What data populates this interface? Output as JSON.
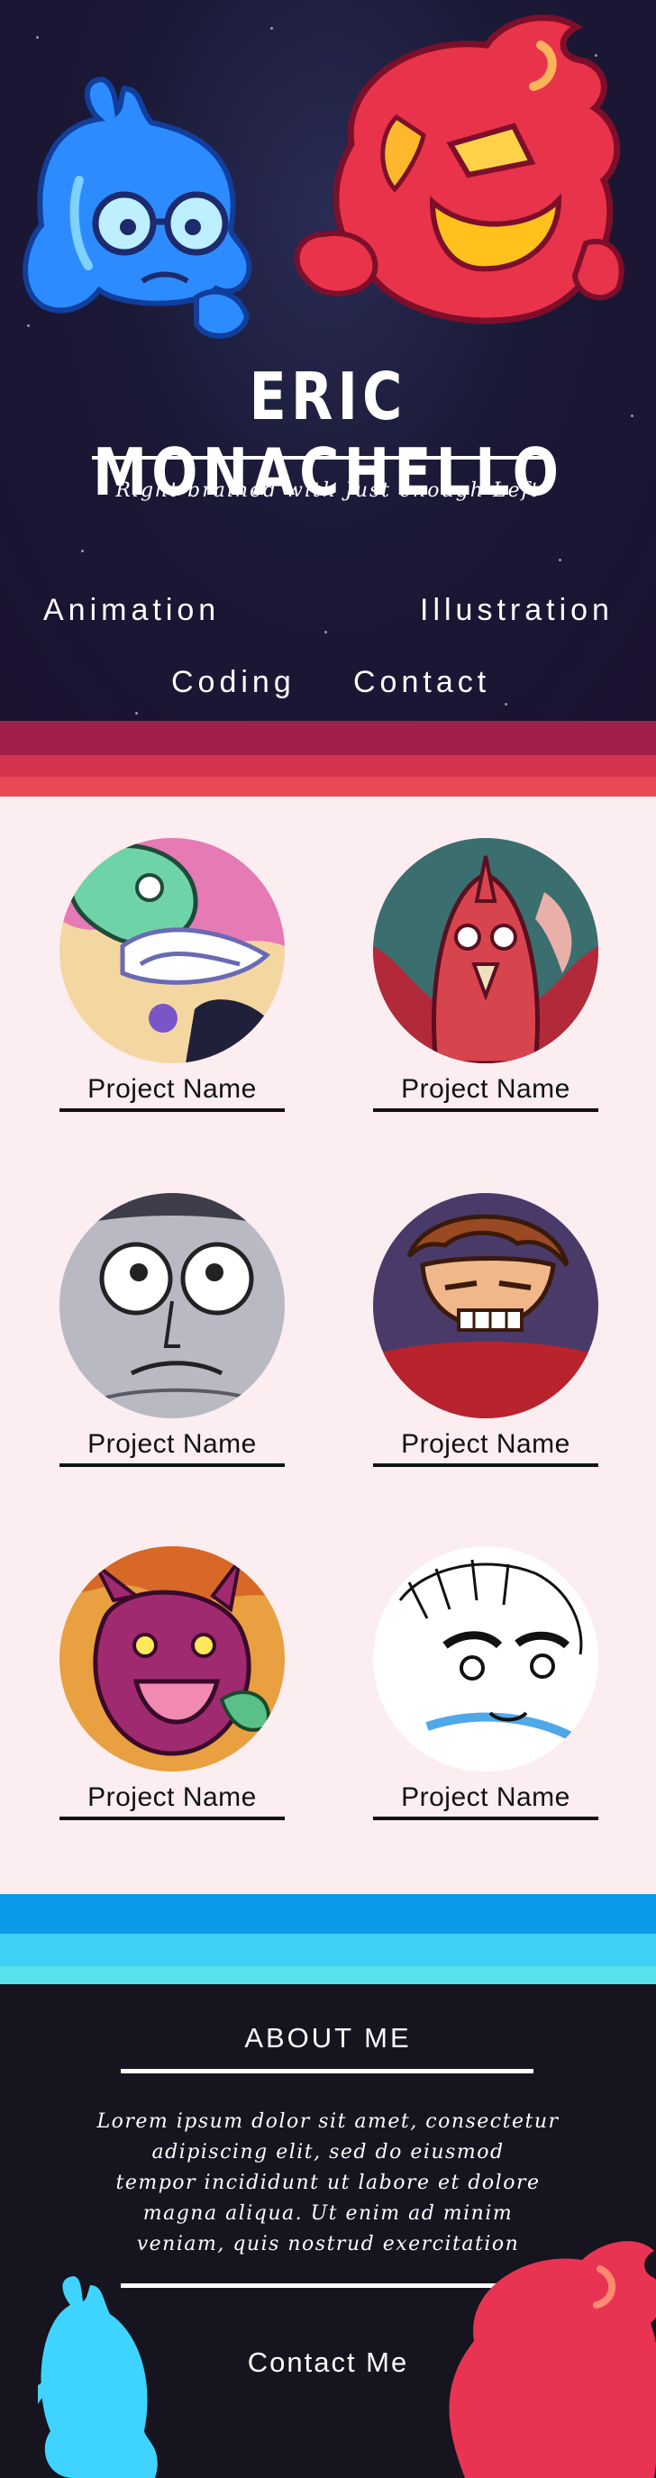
{
  "header": {
    "title": "ERIC MONACHELLO",
    "tagline": "Right brained with Just enough Left"
  },
  "nav": {
    "animation": "Animation",
    "illustration": "Illustration",
    "coding": "Coding",
    "contact": "Contact"
  },
  "projects": [
    {
      "label": "Project Name",
      "thumb": "green-creature-thumbnail"
    },
    {
      "label": "Project Name",
      "thumb": "red-bird-thumbnail"
    },
    {
      "label": "Project Name",
      "thumb": "wide-eyed-face-thumbnail"
    },
    {
      "label": "Project Name",
      "thumb": "gritting-teeth-boy-thumbnail"
    },
    {
      "label": "Project Name",
      "thumb": "purple-dragon-thumbnail"
    },
    {
      "label": "Project Name",
      "thumb": "ink-sketch-thumbnail"
    }
  ],
  "about": {
    "title": "ABOUT ME",
    "lines": [
      "Lorem ipsum dolor sit amet, consectetur",
      "adipiscing elit, sed do eiusmod",
      "tempor incididunt ut labore et dolore",
      "magna aliqua. Ut enim ad minim",
      "veniam, quis nostrud exercitation"
    ],
    "contact": "Contact Me"
  },
  "colors": {
    "hero_bg": "#1b1a36",
    "red_stripe_dark": "#a0204a",
    "red_stripe_mid": "#d5344e",
    "red_stripe_light": "#e84a55",
    "projects_bg": "#fcedf1",
    "blue_stripe_1": "#0b9be8",
    "blue_stripe_2": "#3fd0f5",
    "blue_stripe_3": "#58e1ec",
    "about_bg": "#15141f"
  }
}
